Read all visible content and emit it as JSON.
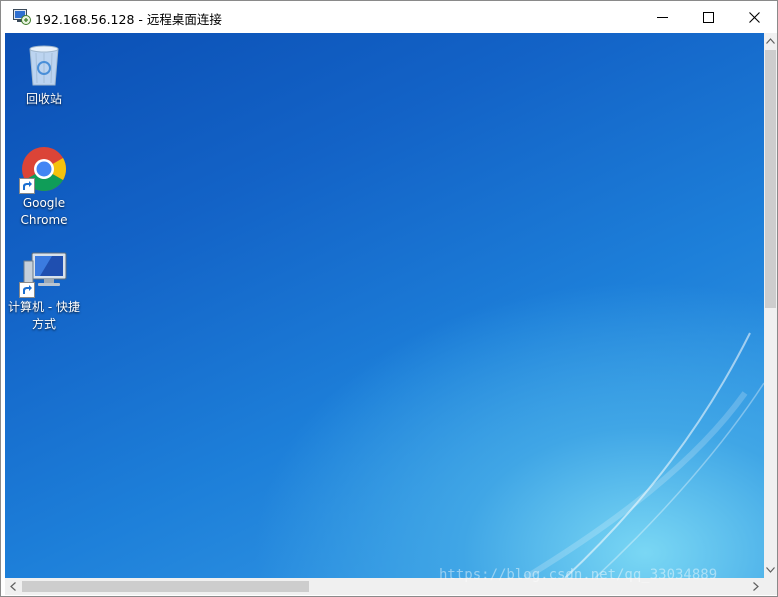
{
  "window": {
    "title": "192.168.56.128 - 远程桌面连接",
    "app_icon": "remote-desktop-icon",
    "controls": {
      "minimize": "minimize-icon",
      "maximize": "maximize-icon",
      "close": "close-icon"
    }
  },
  "desktop": {
    "icons": [
      {
        "label": "回收站",
        "icon": "recycle-bin-icon"
      },
      {
        "label": "Google Chrome",
        "icon": "chrome-icon"
      },
      {
        "label": "计算机 - 快捷方式",
        "icon": "computer-icon"
      }
    ],
    "wallpaper_colors": {
      "top": "#0b4fb4",
      "bottom": "#7ad7f4"
    }
  },
  "watermark": "https://blog.csdn.net/qq_33034889"
}
